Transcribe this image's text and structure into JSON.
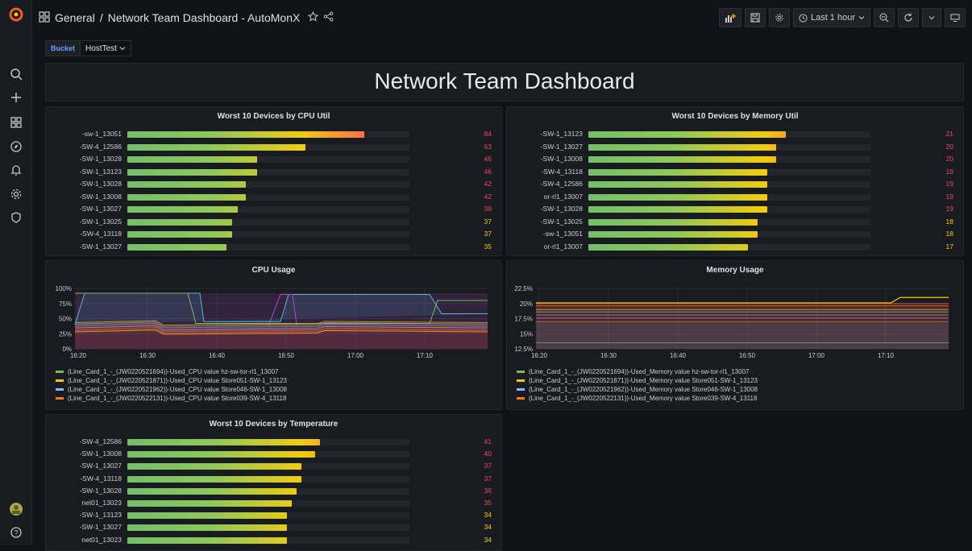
{
  "header": {
    "breadcrumb_folder": "General",
    "separator": "/",
    "dashboard_title": "Network Team Dashboard - AutoMonX",
    "time_range": "Last 1 hour"
  },
  "variables": {
    "bucket_label": "Bucket",
    "bucket_value": "HostTest"
  },
  "banner": {
    "title": "Network Team Dashboard"
  },
  "cpu_util": {
    "title": "Worst 10 Devices by CPU Util",
    "rows": [
      {
        "label": "-sw-1_13051",
        "value": 84
      },
      {
        "label": "-SW-4_12586",
        "value": 63
      },
      {
        "label": "-SW-1_13028",
        "value": 46
      },
      {
        "label": "-SW-1_13123",
        "value": 46
      },
      {
        "label": "-SW-1_13028",
        "value": 42
      },
      {
        "label": "-SW-1_13008",
        "value": 42
      },
      {
        "label": "-SW-1_13027",
        "value": 39
      },
      {
        "label": "-SW-1_13025",
        "value": 37
      },
      {
        "label": "-SW-4_13118",
        "value": 37
      },
      {
        "label": "-SW-1_13027",
        "value": 35
      }
    ]
  },
  "mem_util": {
    "title": "Worst 10 Devices by Memory Util",
    "rows": [
      {
        "label": "-SW-1_13123",
        "value": 21
      },
      {
        "label": "-SW-1_13027",
        "value": 20
      },
      {
        "label": "-SW-1_13008",
        "value": 20
      },
      {
        "label": "-SW-4_13118",
        "value": 19
      },
      {
        "label": "-SW-4_12586",
        "value": 19
      },
      {
        "label": "or-rl1_13007",
        "value": 19
      },
      {
        "label": "-SW-1_13028",
        "value": 19
      },
      {
        "label": "-SW-1_13025",
        "value": 18
      },
      {
        "label": "-sw-1_13051",
        "value": 18
      },
      {
        "label": "or-rl1_13007",
        "value": 17
      }
    ]
  },
  "temperature": {
    "title": "Worst 10 Devices by Temperature",
    "rows": [
      {
        "label": "-SW-4_12586",
        "value": 41
      },
      {
        "label": "-SW-1_13008",
        "value": 40
      },
      {
        "label": "-SW-1_13027",
        "value": 37
      },
      {
        "label": "-SW-4_13118",
        "value": 37
      },
      {
        "label": "-SW-1_13028",
        "value": 36
      },
      {
        "label": "net01_13023",
        "value": 35
      },
      {
        "label": "-SW-1_13123",
        "value": 34
      },
      {
        "label": "-SW-1_13027",
        "value": 34
      },
      {
        "label": "net01_13023",
        "value": 34
      }
    ]
  },
  "cpu_usage": {
    "title": "CPU Usage",
    "y_ticks": [
      "100%",
      "75%",
      "50%",
      "25%",
      "0%"
    ],
    "x_ticks": [
      "16:20",
      "16:30",
      "16:40",
      "16:50",
      "17:00",
      "17:10"
    ],
    "legend": [
      {
        "label": "(Line_Card_1_-_(JW0220521694))-Used_CPU value hz-sw-tor-rl1_13007",
        "color": "#73bf69"
      },
      {
        "label": "(Line_Card_1_-_(JW0220521871))-Used_CPU value Store051-SW-1_13123",
        "color": "#f2cc0c"
      },
      {
        "label": "(Line_Card_1_-_(JW0220521962))-Used_CPU value Store046-SW-1_13008",
        "color": "#8ab8ff"
      },
      {
        "label": "(Line_Card_1_-_(JW0220522131))-Used_CPU value Store039-SW-4_13118",
        "color": "#ff780a"
      }
    ]
  },
  "memory_usage": {
    "title": "Memory Usage",
    "y_ticks": [
      "22.5%",
      "20%",
      "17.5%",
      "15%",
      "12.5%"
    ],
    "x_ticks": [
      "16:20",
      "16:30",
      "16:40",
      "16:50",
      "17:00",
      "17:10"
    ],
    "legend": [
      {
        "label": "(Line_Card_1_-_(JW0220521694))-Used_Memory value hz-sw-tor-rl1_13007",
        "color": "#73bf69"
      },
      {
        "label": "(Line_Card_1_-_(JW0220521871))-Used_Memory value Store051-SW-1_13123",
        "color": "#f2cc0c"
      },
      {
        "label": "(Line_Card_1_-_(JW0220521962))-Used_Memory value Store046-SW-1_13008",
        "color": "#8ab8ff"
      },
      {
        "label": "(Line_Card_1_-_(JW0220522131))-Used_Memory value Store039-SW-4_13118",
        "color": "#ff780a"
      }
    ]
  }
}
